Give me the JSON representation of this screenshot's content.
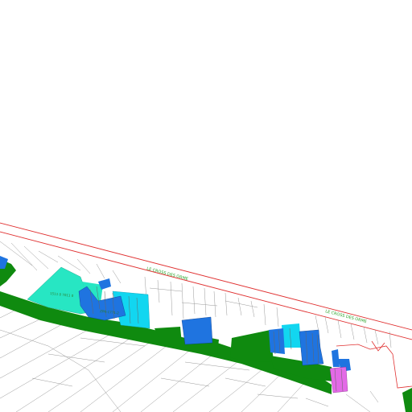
{
  "map": {
    "road_labels": [
      "LE CROSS DES ORME",
      "LE CROSS DES ORME"
    ],
    "parcel_labels": [
      "1511 0 7011 0",
      "ZPN-1771-2"
    ],
    "colors": {
      "background": "#ffffff",
      "road_boundary": "#e03030",
      "forest": "#0f8a0f",
      "aqua": "#27e6c3",
      "cyan": "#12d6f0",
      "blue": "#1f74e0",
      "magenta": "#e36ae6",
      "parcel_lines": "#9a9a9a"
    }
  }
}
